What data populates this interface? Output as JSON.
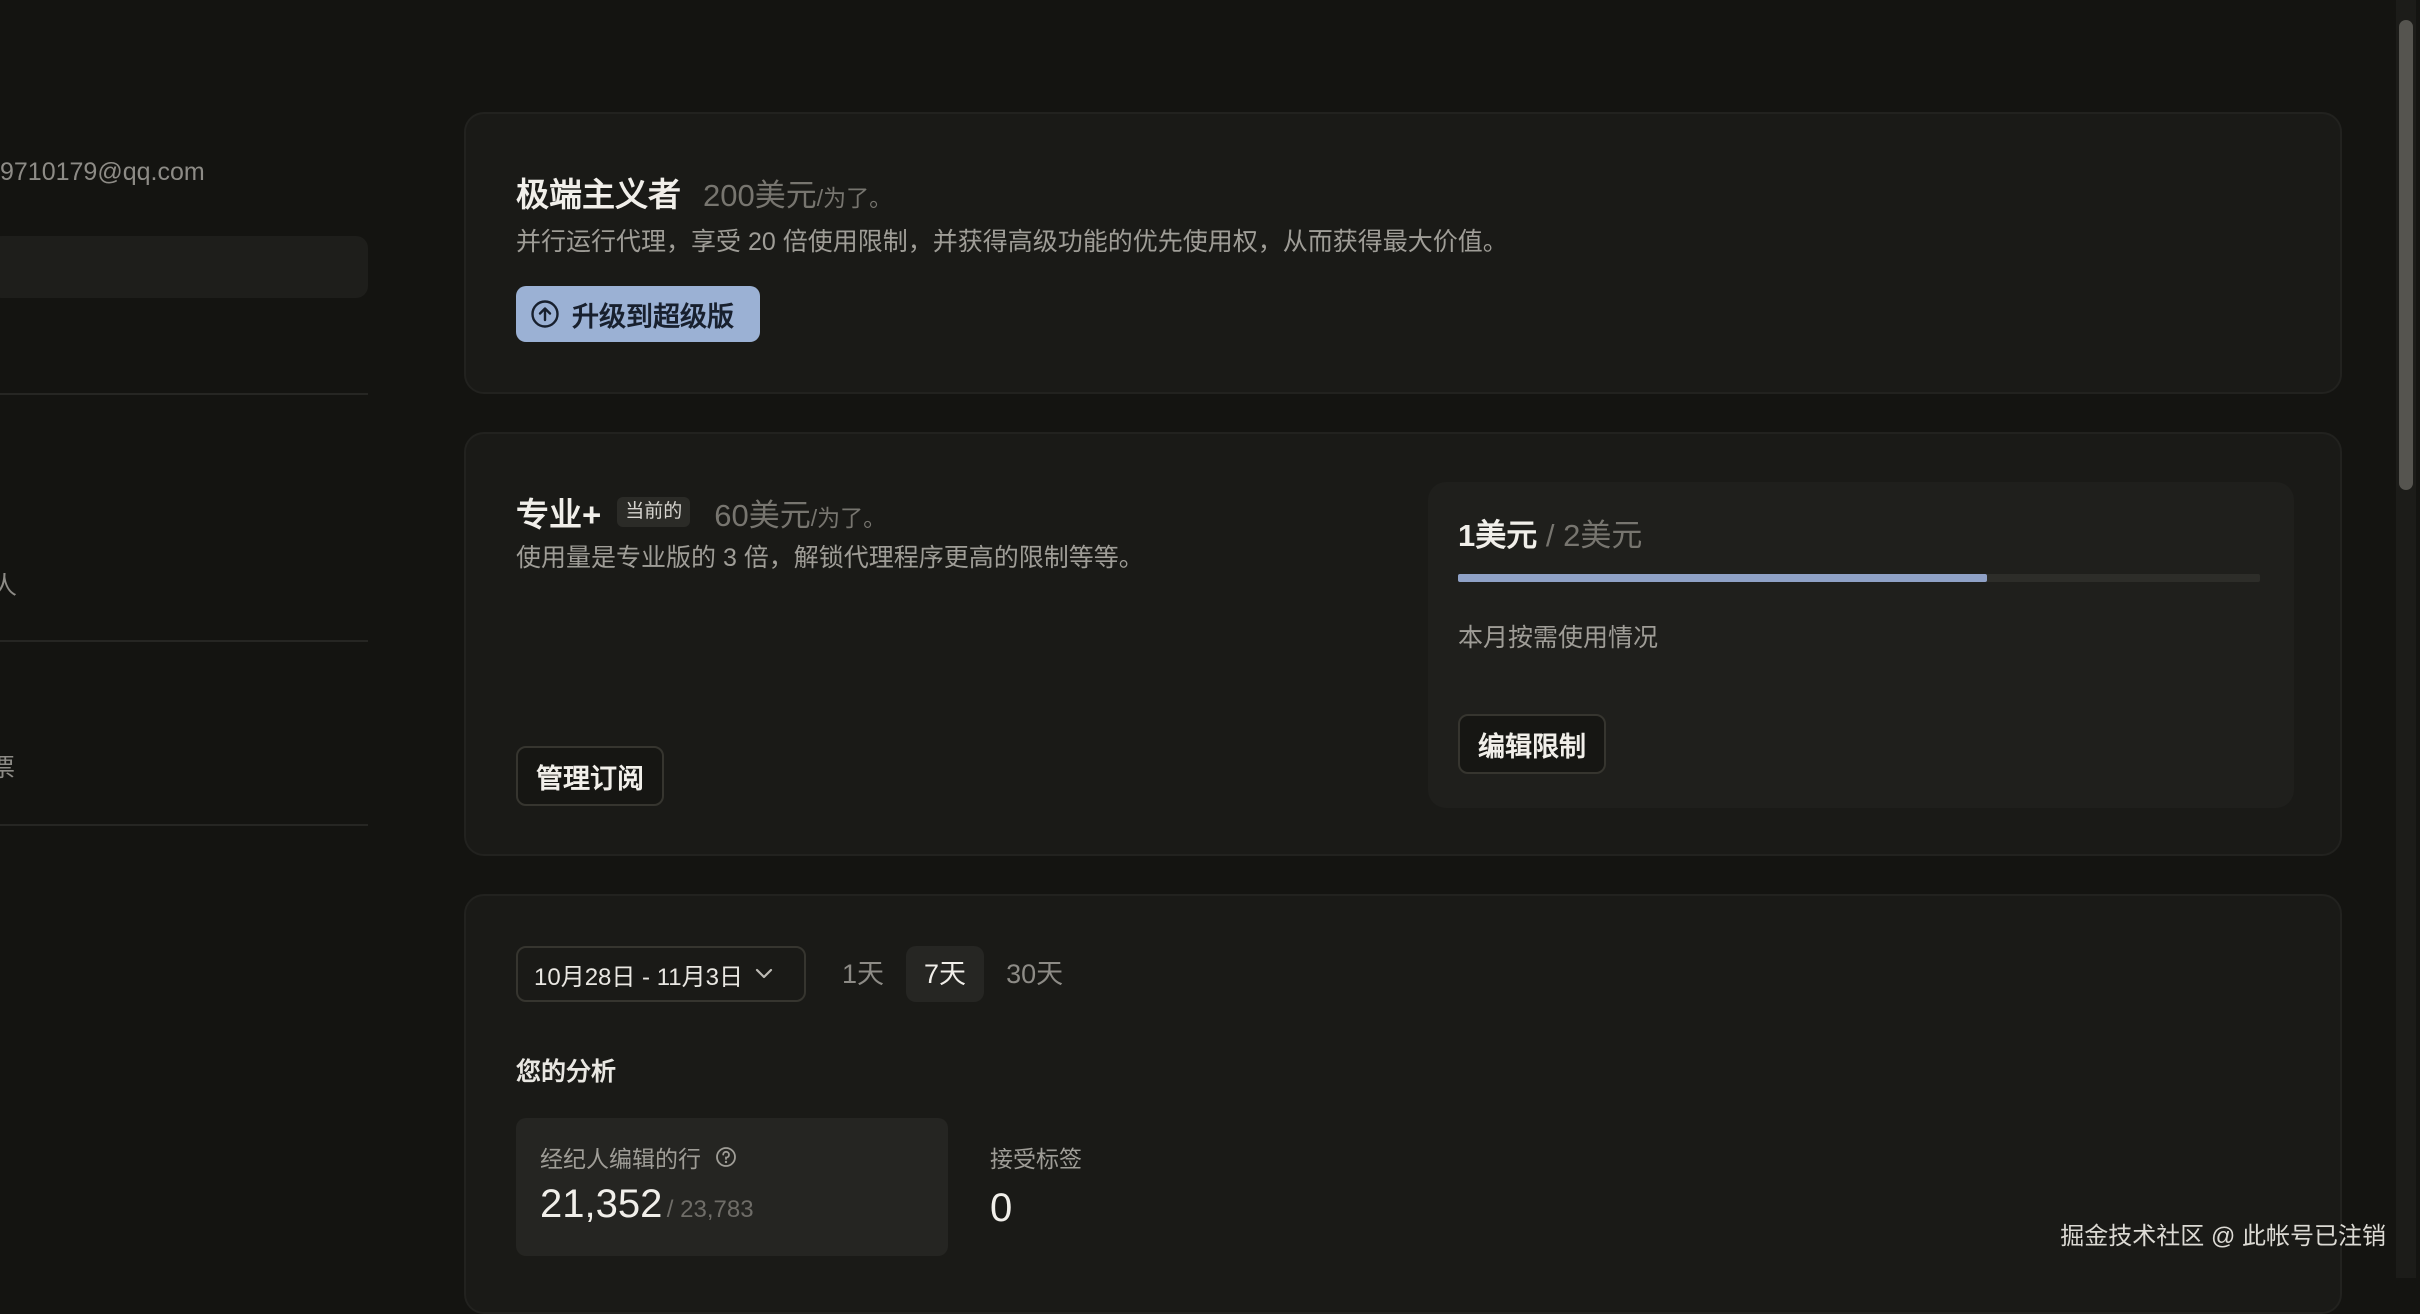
{
  "sidebar": {
    "email": "9710179@qq.com",
    "fragment_1": "人",
    "fragment_2": "票"
  },
  "ultra": {
    "title": "极端主义者",
    "price": "200美元",
    "period": "/为了。",
    "description": "并行运行代理，享受 20 倍使用限制，并获得高级功能的优先使用权，从而获得最大价值。",
    "upgrade_label": "升级到超级版",
    "icon": "arrow-up-circle-icon"
  },
  "pro_plus": {
    "title": "专业+",
    "badge": "当前的",
    "price": "60美元",
    "period": "/为了。",
    "description": "使用量是专业版的 3 倍，解锁代理程序更高的限制等等。",
    "manage_label": "管理订阅"
  },
  "usage": {
    "spent": "1美元",
    "separator": "/",
    "limit": "2美元",
    "progress_fraction": 0.66,
    "label": "本月按需使用情况",
    "edit_label": "编辑限制",
    "bar_color": "#8fa1c6"
  },
  "analytics": {
    "date_range": "10月28日 - 11月3日",
    "ranges": [
      "1天",
      "7天",
      "30天"
    ],
    "active_range": "7天",
    "section_title": "您的分析",
    "stat1": {
      "label": "经纪人编辑的行",
      "value": "21,352",
      "total": "/ 23,783"
    },
    "stat2": {
      "label": "接受标签",
      "value": "0"
    }
  },
  "watermark": "掘金技术社区 @ 此帐号已注销"
}
